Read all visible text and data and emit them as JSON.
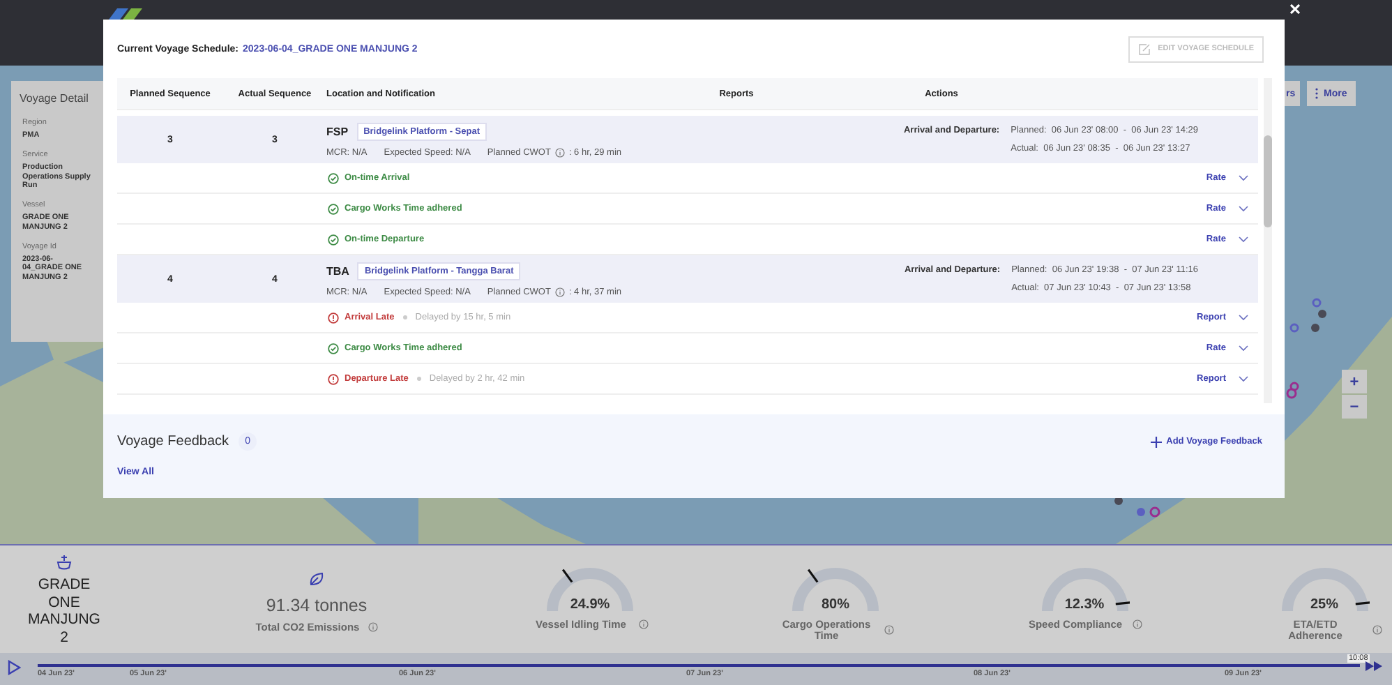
{
  "voyage_details": {
    "title": "Voyage Detail",
    "fields": [
      {
        "label": "Region",
        "value": "PMA"
      },
      {
        "label": "Service",
        "value": "Production Operations Supply Run"
      },
      {
        "label": "Vessel",
        "value": "GRADE ONE MANJUNG 2"
      },
      {
        "label": "Voyage Id",
        "value": "2023-06-04_GRADE ONE MANJUNG 2"
      }
    ]
  },
  "map_buttons": [
    {
      "kind": "plain",
      "label": "rs"
    },
    {
      "kind": "more",
      "label": "More"
    }
  ],
  "zoom_controls": [
    "+",
    "−"
  ],
  "modal": {
    "schedule_label": "Current Voyage Schedule:",
    "schedule_name": "2023-06-04_GRADE ONE MANJUNG 2",
    "edit_button": {
      "label": "EDIT VOYAGE SCHEDULE",
      "disabled": true
    },
    "columns": [
      "Planned Sequence",
      "Actual Sequence",
      "Location and Notification",
      "Reports",
      "Actions"
    ],
    "stops": [
      {
        "planned_sequence": "3",
        "actual_sequence": "3",
        "code": "FSP",
        "location": "Bridgelink Platform - Sepat",
        "mcr": "MCR: N/A",
        "expected_speed": "Expected Speed: N/A",
        "cwot_label": "Planned CWOT",
        "cwot_value": ": 6 hr, 29 min",
        "times_label": "Arrival and Departure:",
        "planned": "Planned:  06 Jun 23' 08:00  -  06 Jun 23' 14:29",
        "actual": "Actual:  06 Jun 23' 08:35  -  06 Jun 23' 13:27",
        "notifications": [
          {
            "kind": "ok",
            "label": "On-time Arrival",
            "action": "Rate"
          },
          {
            "kind": "ok",
            "label": "Cargo Works Time adhered",
            "action": "Rate"
          },
          {
            "kind": "ok",
            "label": "On-time Departure",
            "action": "Rate"
          }
        ]
      },
      {
        "planned_sequence": "4",
        "actual_sequence": "4",
        "code": "TBA",
        "location": "Bridgelink Platform - Tangga Barat",
        "mcr": "MCR: N/A",
        "expected_speed": "Expected Speed: N/A",
        "cwot_label": "Planned CWOT",
        "cwot_value": ": 4 hr, 37 min",
        "times_label": "Arrival and Departure:",
        "planned": "Planned:  06 Jun 23' 19:38  -  07 Jun 23' 11:16",
        "actual": "Actual:  07 Jun 23' 10:43  -  07 Jun 23' 13:58",
        "notifications": [
          {
            "kind": "late",
            "label": "Arrival Late",
            "delay": "Delayed by 15 hr, 5 min",
            "action": "Report"
          },
          {
            "kind": "ok",
            "label": "Cargo Works Time adhered",
            "action": "Rate"
          },
          {
            "kind": "late",
            "label": "Departure Late",
            "delay": "Delayed by 2 hr, 42 min",
            "action": "Report"
          }
        ]
      }
    ],
    "feedback": {
      "title": "Voyage Feedback",
      "count": "0",
      "add_label": "Add Voyage Feedback",
      "view_all": "View All"
    }
  },
  "stats": {
    "vessel_name": "GRADE ONE MANJUNG 2",
    "co2_value": "91.34 tonnes",
    "co2_label": "Total CO2 Emissions",
    "gauges": [
      {
        "reading": "24.9%",
        "label": "Vessel Idling Time",
        "level": 0.3
      },
      {
        "reading": "80%",
        "label": "Cargo Operations Time",
        "level": 0.3
      },
      {
        "reading": "12.3%",
        "label": "Speed Compliance",
        "level": 0.97
      },
      {
        "reading": "25%",
        "label": "ETA/ETD Adherence",
        "level": 0.97
      }
    ]
  },
  "timeline": {
    "dates": [
      "04 Jun 23'",
      "05 Jun 23'",
      "06 Jun 23'",
      "07 Jun 23'",
      "08 Jun 23'",
      "09 Jun 23'"
    ],
    "current_time": "10:08"
  }
}
